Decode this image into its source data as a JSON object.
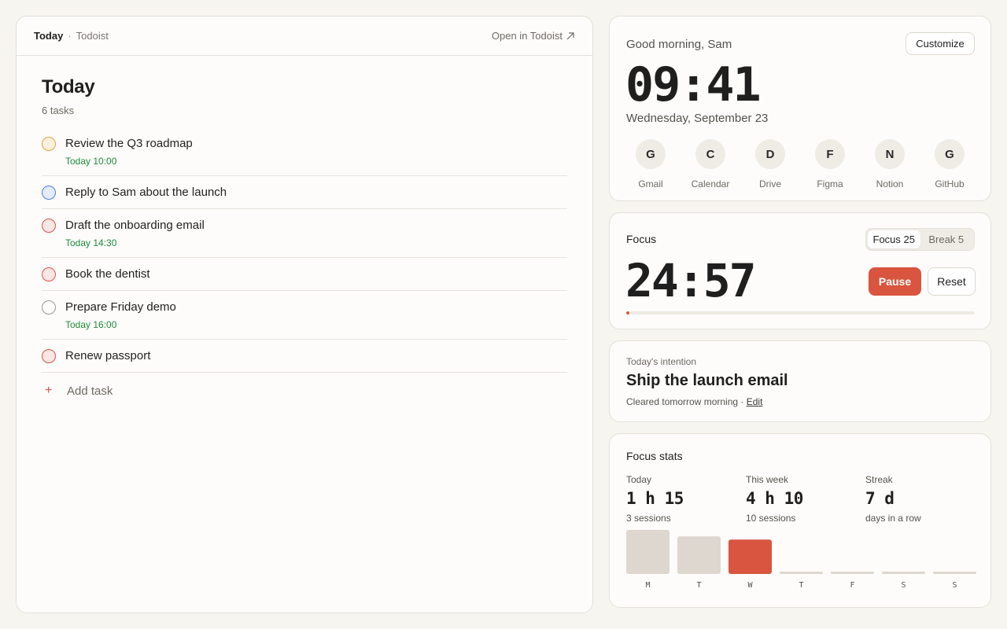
{
  "tasks_panel": {
    "breadcrumb_current": "Today",
    "breadcrumb_source": "Todoist",
    "open_link": "Open in Todoist",
    "title": "Today",
    "count": "6 tasks",
    "tasks": [
      {
        "title": "Review the Q3 roadmap",
        "due": "Today 10:00",
        "priority": "orange"
      },
      {
        "title": "Reply to Sam about the launch",
        "due": "",
        "priority": "blue"
      },
      {
        "title": "Draft the onboarding email",
        "due": "Today 14:30",
        "priority": "red"
      },
      {
        "title": "Book the dentist",
        "due": "",
        "priority": "red"
      },
      {
        "title": "Prepare Friday demo",
        "due": "Today 16:00",
        "priority": "none"
      },
      {
        "title": "Renew passport",
        "due": "",
        "priority": "red"
      }
    ],
    "add_task": "Add task"
  },
  "clock": {
    "greeting": "Good morning, Sam",
    "customize": "Customize",
    "time": "09:41",
    "date": "Wednesday, September 23",
    "apps": [
      {
        "letter": "G",
        "label": "Gmail"
      },
      {
        "letter": "C",
        "label": "Calendar"
      },
      {
        "letter": "D",
        "label": "Drive"
      },
      {
        "letter": "F",
        "label": "Figma"
      },
      {
        "letter": "N",
        "label": "Notion"
      },
      {
        "letter": "G",
        "label": "GitHub"
      }
    ]
  },
  "focus": {
    "title": "Focus",
    "mode_focus": "Focus 25",
    "mode_break": "Break 5",
    "active_mode": "focus",
    "time": "24:57",
    "pause": "Pause",
    "reset": "Reset",
    "progress": 0.002
  },
  "intention": {
    "label": "Today's intention",
    "text": "Ship the launch email",
    "sub": "Cleared tomorrow morning",
    "sep": "·",
    "edit": "Edit"
  },
  "stats": {
    "title": "Focus stats",
    "today": {
      "label": "Today",
      "value": "1 h 15",
      "sub": "3 sessions"
    },
    "week": {
      "label": "This week",
      "value": "4 h 10",
      "sub": "10 sessions"
    },
    "streak": {
      "label": "Streak",
      "value": "7 d",
      "sub": "days in a row"
    }
  },
  "colors": {
    "accent": "#d9553f",
    "bar_default": "#ddd7d0",
    "due_green": "#1e8a3c"
  },
  "chart_data": {
    "type": "bar",
    "categories": [
      "M",
      "T",
      "W",
      "T",
      "F",
      "S",
      "S"
    ],
    "values": [
      55,
      47,
      43,
      0,
      0,
      0,
      0
    ],
    "highlight_index": 2,
    "grid": false
  }
}
